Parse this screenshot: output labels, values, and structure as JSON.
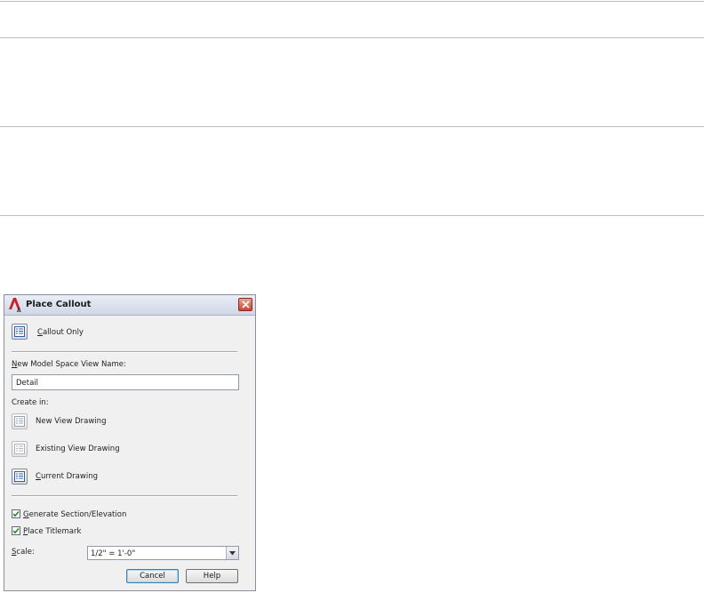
{
  "dialog": {
    "title": "Place Callout",
    "callout_only_label": "Callout Only",
    "view_name_label": "New Model Space View Name:",
    "view_name_value": "Detail",
    "create_in_label": "Create in:",
    "new_view_drawing_label": "New View Drawing",
    "existing_view_drawing_label": "Existing View Drawing",
    "current_drawing_label": "Current Drawing",
    "generate_section_label": "Generate Section/Elevation",
    "generate_section_checked": true,
    "place_titlemark_label": "Place Titlemark",
    "place_titlemark_checked": true,
    "scale_label": "Scale:",
    "scale_value": "1/2\" = 1'-0\"",
    "cancel_label": "Cancel",
    "help_label": "Help"
  },
  "icons": {
    "app": "autocad-app-icon",
    "close": "close-icon",
    "callout_only": "callout-only-icon",
    "new_view_drawing": "new-view-drawing-icon",
    "existing_view_drawing": "existing-view-drawing-icon",
    "current_drawing": "current-drawing-icon",
    "checkmark": "checkmark-icon",
    "dropdown": "chevron-down-icon"
  },
  "colors": {
    "close_button": "#c9452f",
    "checkmark": "#1e8a1e",
    "icon_blue": "#2f5fa8"
  }
}
